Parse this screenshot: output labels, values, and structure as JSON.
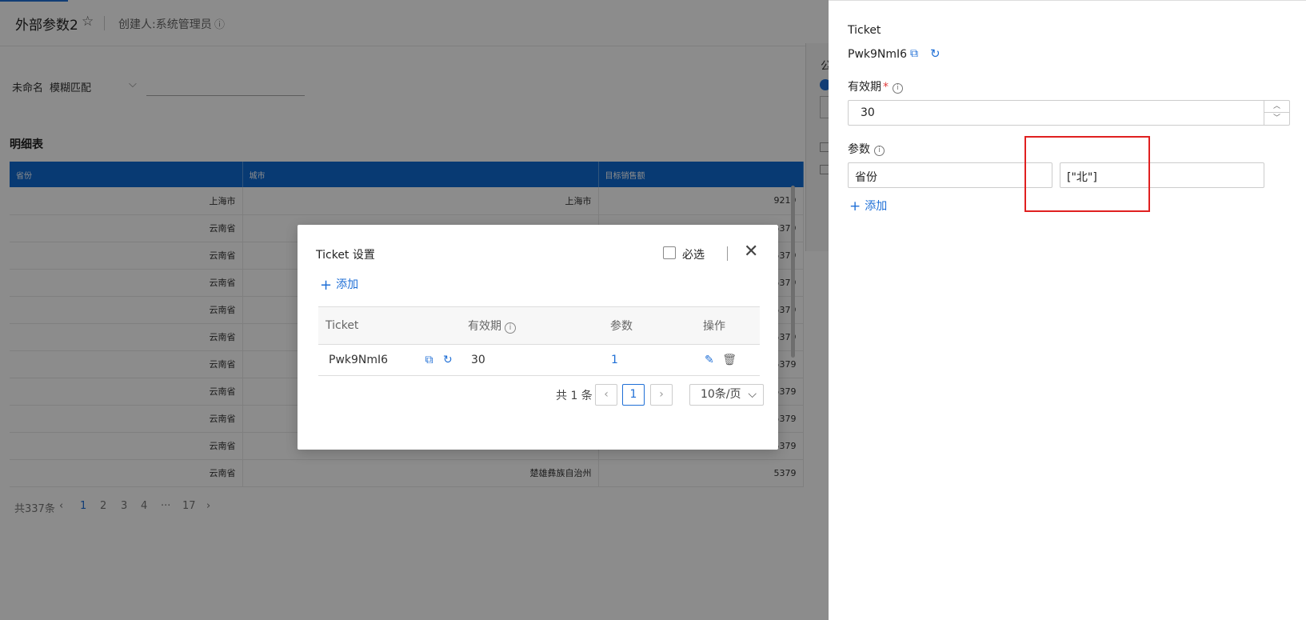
{
  "header": {
    "title": "外部参数2",
    "creator": "创建人:系统管理员"
  },
  "filter": {
    "field_label": "未命名",
    "match_mode": "模糊匹配"
  },
  "detail": {
    "title": "明细表",
    "columns": [
      "省份",
      "城市",
      "目标销售额"
    ],
    "rows": [
      [
        "上海市",
        "上海市",
        "9219"
      ],
      [
        "云南省",
        "",
        "5379"
      ],
      [
        "云南省",
        "",
        "5379"
      ],
      [
        "云南省",
        "",
        "5379"
      ],
      [
        "云南省",
        "",
        "5379"
      ],
      [
        "云南省",
        "",
        "5379"
      ],
      [
        "云南省",
        "",
        "5379"
      ],
      [
        "云南省",
        "",
        "5379"
      ],
      [
        "云南省",
        "",
        "5379"
      ],
      [
        "云南省",
        "",
        "5379"
      ],
      [
        "云南省",
        "楚雄彝族自治州",
        "5379"
      ]
    ],
    "pager": {
      "total": "共337条",
      "pages": [
        "1",
        "2",
        "3",
        "4",
        "···",
        "17"
      ],
      "active": "1"
    }
  },
  "modal": {
    "title": "Ticket 设置",
    "required_label": "必选",
    "add_label": "添加",
    "columns": {
      "ticket": "Ticket",
      "expire": "有效期",
      "params": "参数",
      "actions": "操作"
    },
    "rows": [
      {
        "ticket": "Pwk9NmI6",
        "expire": "30",
        "params": "1"
      }
    ],
    "pager": {
      "total": "共 1 条",
      "current": "1",
      "page_size": "10条/页"
    }
  },
  "drawer": {
    "ticket_label": "Ticket",
    "ticket_value": "Pwk9NmI6",
    "expire_label": "有效期",
    "expire_value": "30",
    "params_label": "参数",
    "param_key": "省份",
    "param_value": "[\"北\"]",
    "add_label": "添加"
  },
  "colors": {
    "accent": "#1f6fd6",
    "table_header": "#0f6ad1",
    "highlight": "#e02020",
    "required": "#e03c3c"
  },
  "icons": [
    "star-icon",
    "info-icon",
    "chevron-down-icon",
    "close-icon",
    "plus-icon",
    "copy-icon",
    "refresh-icon",
    "edit-icon",
    "delete-icon",
    "chevron-left-icon",
    "chevron-right-icon",
    "chevron-up-icon"
  ]
}
